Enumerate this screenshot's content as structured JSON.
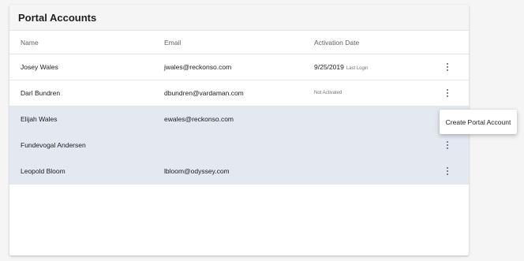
{
  "card": {
    "title": "Portal Accounts"
  },
  "table": {
    "columns": {
      "name": "Name",
      "email": "Email",
      "activation": "Activation Date"
    },
    "rows": [
      {
        "name": "Josey Wales",
        "email": "jwales@reckonso.com",
        "date": "9/25/2019",
        "status": "Last Login",
        "selected": false,
        "menu": true
      },
      {
        "name": "Darl Bundren",
        "email": "dbundren@vardaman.com",
        "date": "",
        "status": "Not Activated",
        "selected": false,
        "menu": true
      },
      {
        "name": "Elijah Wales",
        "email": "ewales@reckonso.com",
        "date": "",
        "status": "",
        "selected": true,
        "menu": false
      },
      {
        "name": "Fundevogal Andersen",
        "email": "",
        "date": "",
        "status": "",
        "selected": true,
        "menu": true
      },
      {
        "name": "Leopold Bloom",
        "email": "lbloom@odyssey.com",
        "date": "",
        "status": "",
        "selected": true,
        "menu": true
      }
    ]
  },
  "context_menu": {
    "item": "Create Portal Account"
  }
}
